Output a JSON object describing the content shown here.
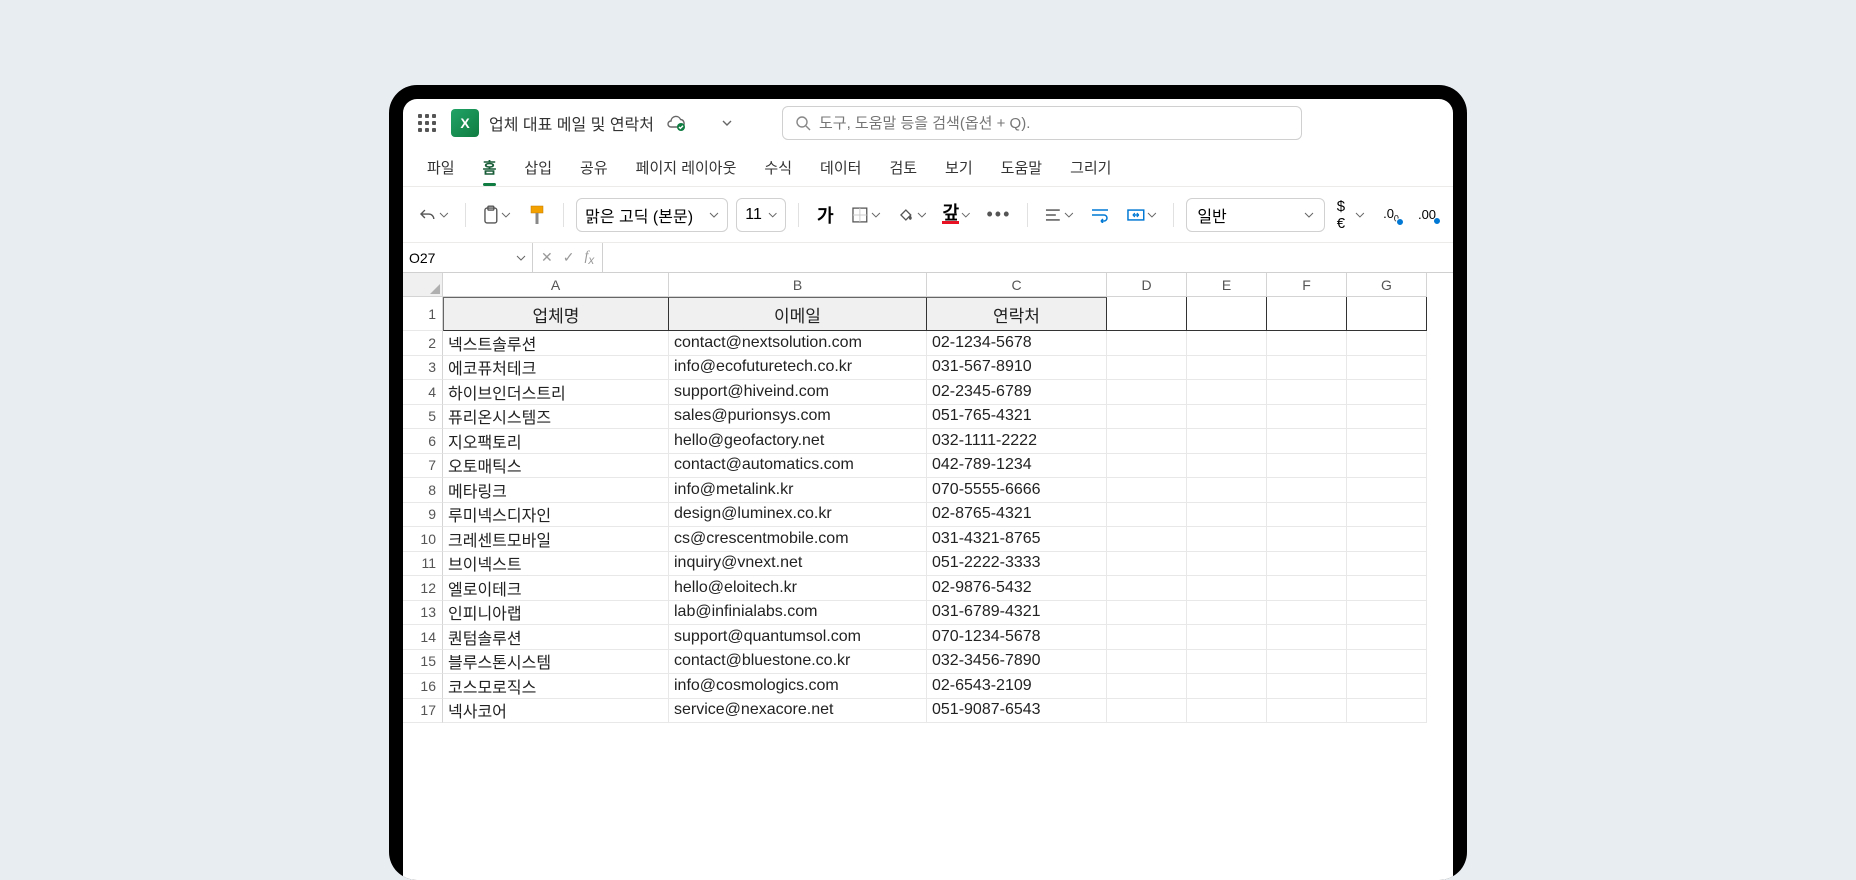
{
  "title": "업체 대표 메일 및 연락처",
  "search_placeholder": "도구, 도움말 등을 검색(옵션 + Q).",
  "tabs": [
    "파일",
    "홈",
    "삽입",
    "공유",
    "페이지 레이아웃",
    "수식",
    "데이터",
    "검토",
    "보기",
    "도움말",
    "그리기"
  ],
  "active_tab": 1,
  "font_name": "맑은 고딕 (본문)",
  "font_size": "11",
  "number_format": "일반",
  "namebox": "O27",
  "formula": "",
  "columns": [
    "A",
    "B",
    "C",
    "D",
    "E",
    "F",
    "G"
  ],
  "headers": [
    "업체명",
    "이메일",
    "연락처"
  ],
  "rows": [
    {
      "n": "넥스트솔루션",
      "e": "contact@nextsolution.com",
      "p": "02-1234-5678"
    },
    {
      "n": "에코퓨처테크",
      "e": "info@ecofuturetech.co.kr",
      "p": "031-567-8910"
    },
    {
      "n": "하이브인더스트리",
      "e": "support@hiveind.com",
      "p": "02-2345-6789"
    },
    {
      "n": "퓨리온시스템즈",
      "e": "sales@purionsys.com",
      "p": "051-765-4321"
    },
    {
      "n": "지오팩토리",
      "e": "hello@geofactory.net",
      "p": "032-1111-2222"
    },
    {
      "n": "오토매틱스",
      "e": "contact@automatics.com",
      "p": "042-789-1234"
    },
    {
      "n": "메타링크",
      "e": "info@metalink.kr",
      "p": "070-5555-6666"
    },
    {
      "n": "루미넥스디자인",
      "e": "design@luminex.co.kr",
      "p": "02-8765-4321"
    },
    {
      "n": "크레센트모바일",
      "e": "cs@crescentmobile.com",
      "p": "031-4321-8765"
    },
    {
      "n": "브이넥스트",
      "e": "inquiry@vnext.net",
      "p": "051-2222-3333"
    },
    {
      "n": "엘로이테크",
      "e": "hello@eloitech.kr",
      "p": "02-9876-5432"
    },
    {
      "n": "인피니아랩",
      "e": "lab@infinialabs.com",
      "p": "031-6789-4321"
    },
    {
      "n": "퀀텀솔루션",
      "e": "support@quantumsol.com",
      "p": "070-1234-5678"
    },
    {
      "n": "블루스톤시스템",
      "e": "contact@bluestone.co.kr",
      "p": "032-3456-7890"
    },
    {
      "n": "코스모로직스",
      "e": "info@cosmologics.com",
      "p": "02-6543-2109"
    },
    {
      "n": "넥사코어",
      "e": "service@nexacore.net",
      "p": "051-9087-6543"
    }
  ]
}
